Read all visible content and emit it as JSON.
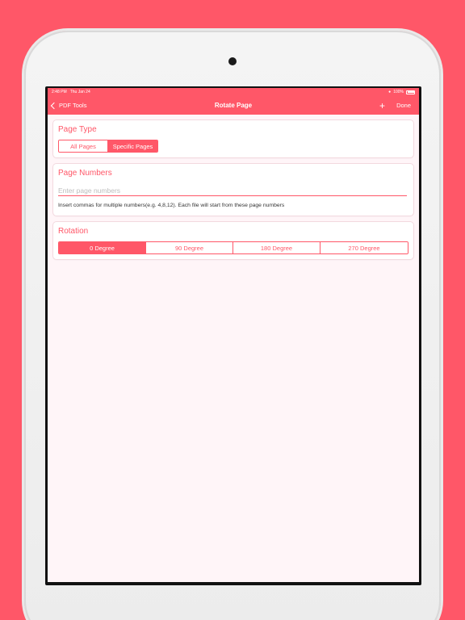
{
  "status_bar": {
    "time": "2:48 PM",
    "date": "Thu Jan 24",
    "battery": "100%"
  },
  "nav": {
    "back_label": "PDF Tools",
    "title": "Rotate Page",
    "add_label": "+",
    "done_label": "Done"
  },
  "page_type": {
    "title": "Page Type",
    "options": [
      "All Pages",
      "Specific Pages"
    ],
    "selected": "Specific Pages"
  },
  "page_numbers": {
    "title": "Page Numbers",
    "placeholder": "Enter page numbers",
    "value": "",
    "hint": "Insert commas for multiple numbers(e.g. 4,8,12). Each file will start from these page numbers"
  },
  "rotation": {
    "title": "Rotation",
    "options": [
      "0 Degree",
      "90 Degree",
      "180 Degree",
      "270 Degree"
    ],
    "selected": "0 Degree"
  },
  "colors": {
    "accent": "#FF5768",
    "background": "#FFF5F8",
    "card": "#FFFFFF"
  }
}
